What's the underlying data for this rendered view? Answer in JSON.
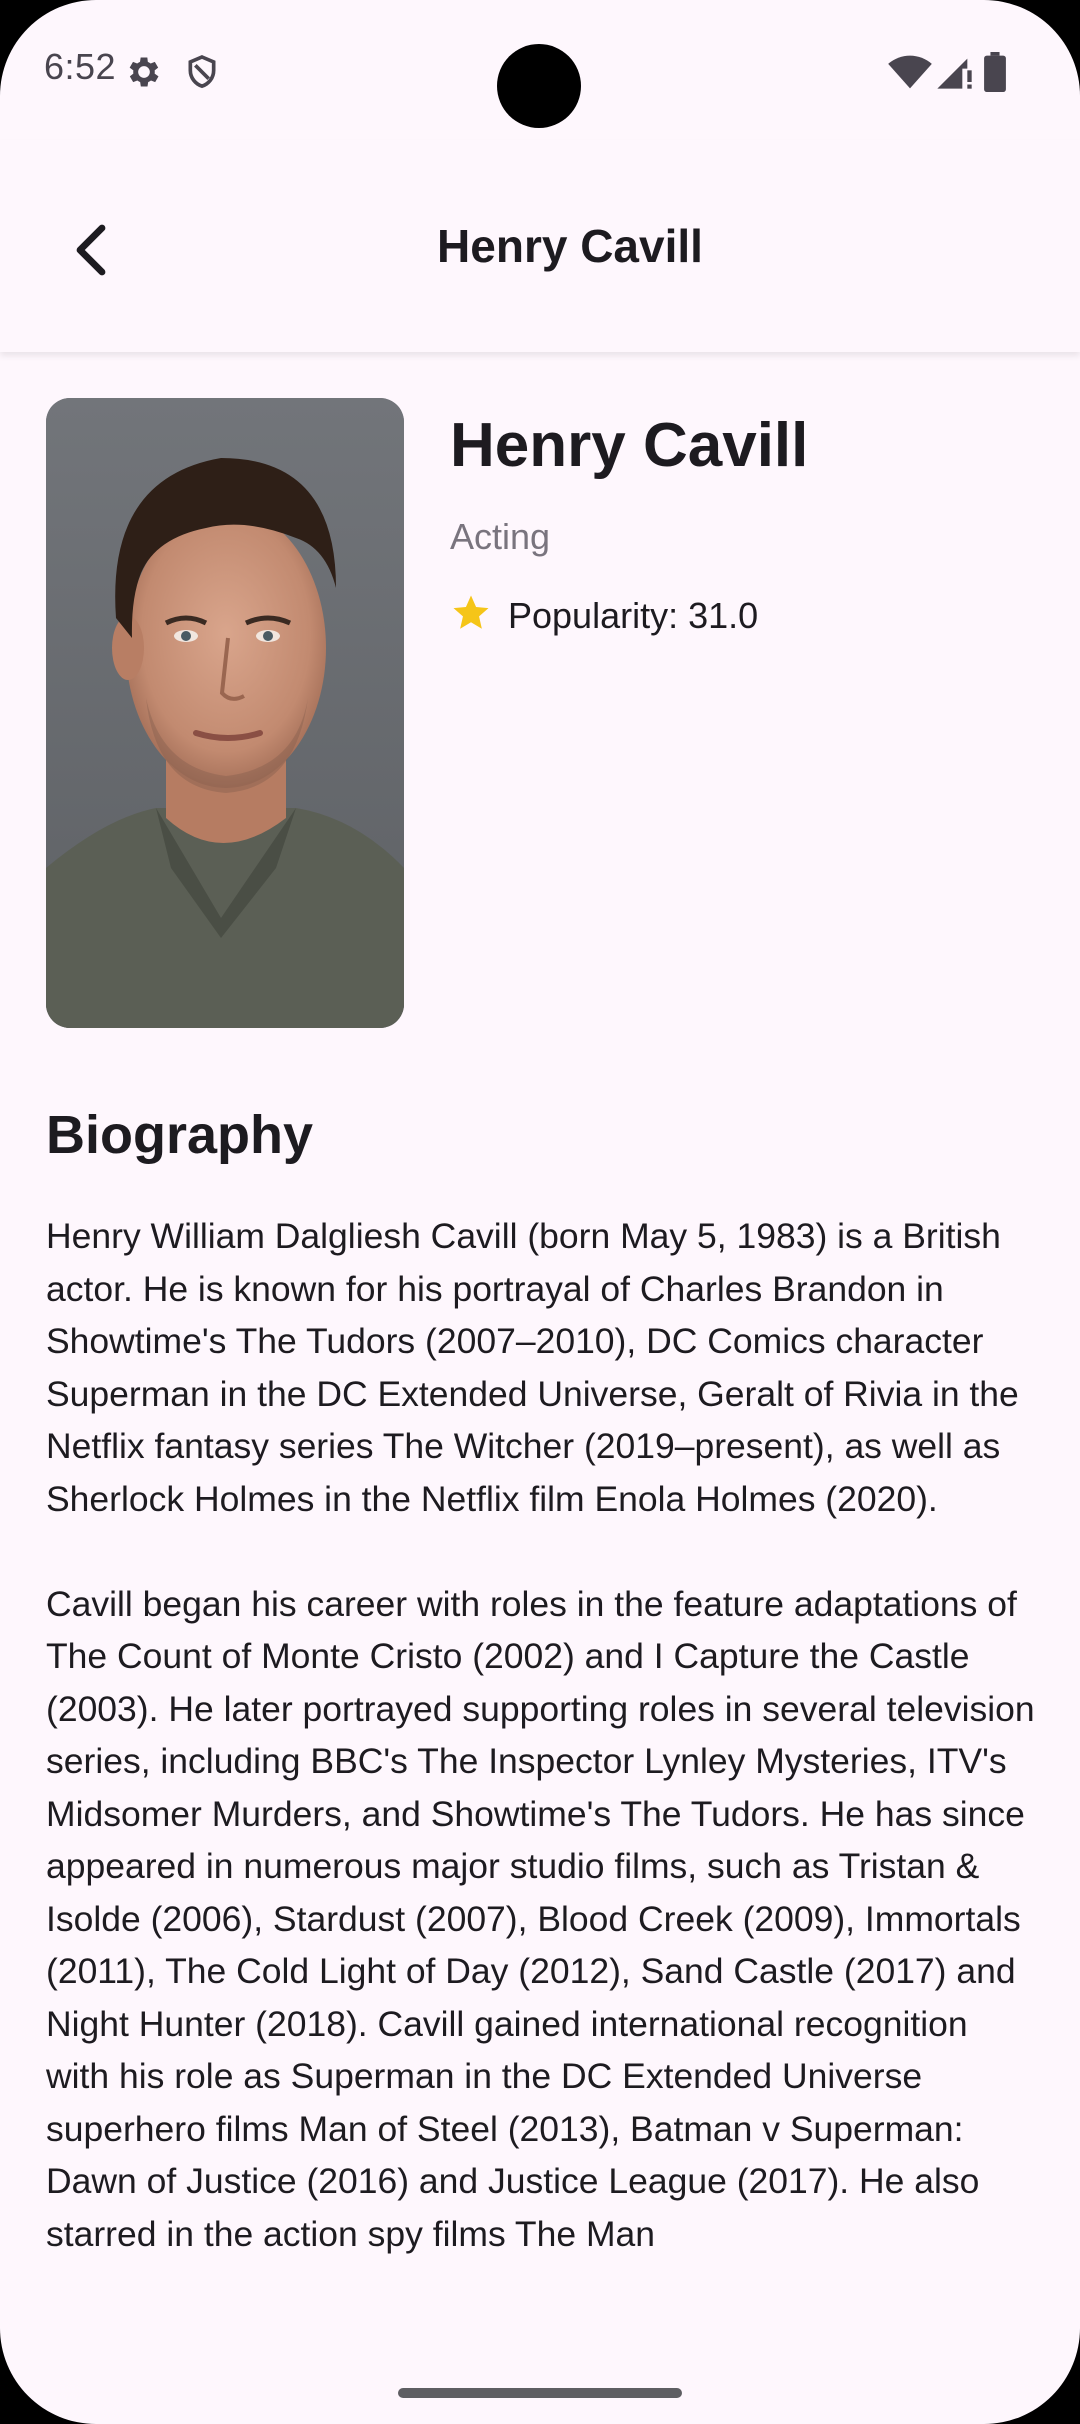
{
  "status_bar": {
    "time": "6:52",
    "icons": [
      "gear-icon",
      "shield-icon",
      "wifi-icon",
      "signal-icon",
      "battery-icon"
    ]
  },
  "app_bar": {
    "title": "Henry Cavill",
    "back_icon": "chevron-left-icon"
  },
  "person": {
    "name": "Henry Cavill",
    "department": "Acting",
    "popularity_label": "Popularity: 31.0",
    "star_color": "#f5c518"
  },
  "biography": {
    "heading": "Biography",
    "text": "Henry William Dalgliesh Cavill (born May 5, 1983) is a British actor. He is known for his portrayal of Charles Brandon in Showtime's The Tudors (2007–2010), DC Comics character Superman in the DC Extended Universe, Geralt of Rivia in the Netflix fantasy series The Witcher (2019–present), as well as Sherlock Holmes in the Netflix film Enola Holmes (2020).\n\nCavill began his career with roles in the feature adaptations of The Count of Monte Cristo (2002) and I Capture the Castle (2003). He later portrayed supporting roles in several television series, including BBC's The Inspector Lynley Mysteries, ITV's Midsomer Murders, and Showtime's The Tudors. He has since appeared in numerous major studio films, such as Tristan & Isolde (2006), Stardust (2007), Blood Creek (2009), Immortals (2011), The Cold Light of Day (2012), Sand Castle (2017) and Night Hunter (2018). Cavill gained international recognition with his role as Superman in the DC Extended Universe superhero films Man of Steel (2013), Batman v Superman: Dawn of Justice (2016) and Justice League (2017). He also starred in the action spy films The Man"
  }
}
